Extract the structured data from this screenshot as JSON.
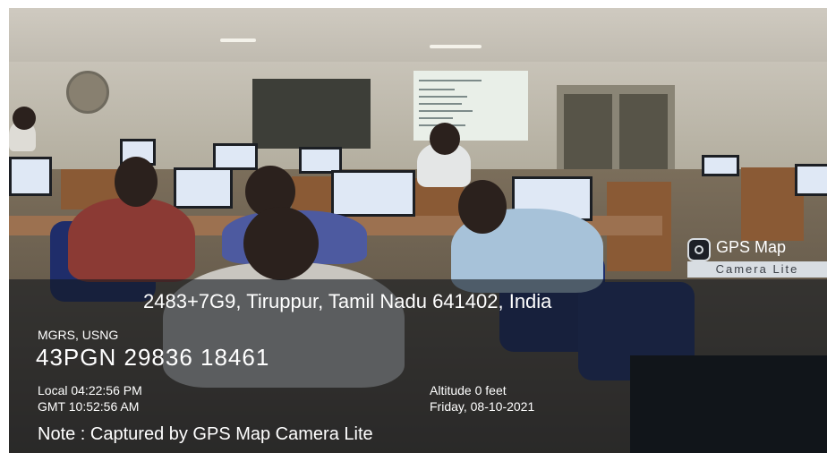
{
  "watermark": {
    "address": "2483+7G9, Tiruppur, Tamil Nadu 641402, India",
    "grid_system_label": "MGRS, USNG",
    "grid_reference": "43PGN 29836 18461",
    "local_time": "Local 04:22:56 PM",
    "gmt_time": "GMT 10:52:56 AM",
    "altitude": "Altitude 0 feet",
    "date": "Friday, 08-10-2021",
    "note": "Note : Captured by GPS Map Camera Lite",
    "logo_title": "GPS Map",
    "logo_subtitle": "Camera Lite",
    "logo_icon": "camera-icon"
  },
  "colors": {
    "overlay": "#12181e",
    "text": "#ffffff",
    "logo_badge": "#d8dde2"
  }
}
